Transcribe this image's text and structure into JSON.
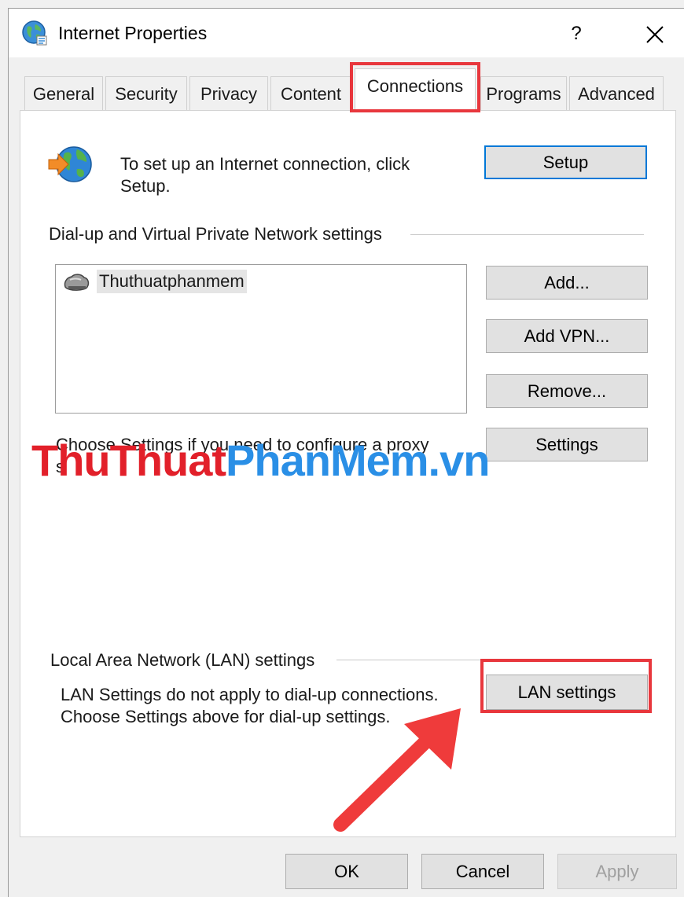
{
  "window": {
    "title": "Internet Properties",
    "help_glyph": "?",
    "close_icon": "close-icon",
    "title_icon": "internet-options-globe-icon"
  },
  "tabs": [
    {
      "label": "General",
      "active": false
    },
    {
      "label": "Security",
      "active": false
    },
    {
      "label": "Privacy",
      "active": false
    },
    {
      "label": "Content",
      "active": false
    },
    {
      "label": "Connections",
      "active": true
    },
    {
      "label": "Programs",
      "active": false
    },
    {
      "label": "Advanced",
      "active": false
    }
  ],
  "setup": {
    "text_line1": "To set up an Internet connection, click",
    "text_line2": "Setup.",
    "button_label": "Setup",
    "icon": "globe-arrow-icon"
  },
  "dialup": {
    "group_label": "Dial-up and Virtual Private Network settings",
    "connections": [
      {
        "name": "Thuthuatphanmem",
        "icon": "dialup-connection-icon"
      }
    ],
    "add_label": "Add...",
    "add_vpn_label": "Add VPN...",
    "remove_label": "Remove...",
    "settings_label": "Settings",
    "proxy_text_line1": "Choose Settings if you need to configure a proxy",
    "proxy_text_line2": "s"
  },
  "lan": {
    "group_label": "Local Area Network (LAN) settings",
    "text_line1": "LAN Settings do not apply to dial-up connections.",
    "text_line2": "Choose Settings above for dial-up settings.",
    "button_label": "LAN settings"
  },
  "footer": {
    "ok_label": "OK",
    "cancel_label": "Cancel",
    "apply_label": "Apply"
  },
  "watermark": {
    "part1": "ThuThuat",
    "part2": "PhanMem.vn"
  },
  "colors": {
    "highlight": "#e8373d",
    "default_button_border": "#0078d7",
    "watermark_red": "#e2202a",
    "watermark_blue": "#2a8fe6"
  }
}
